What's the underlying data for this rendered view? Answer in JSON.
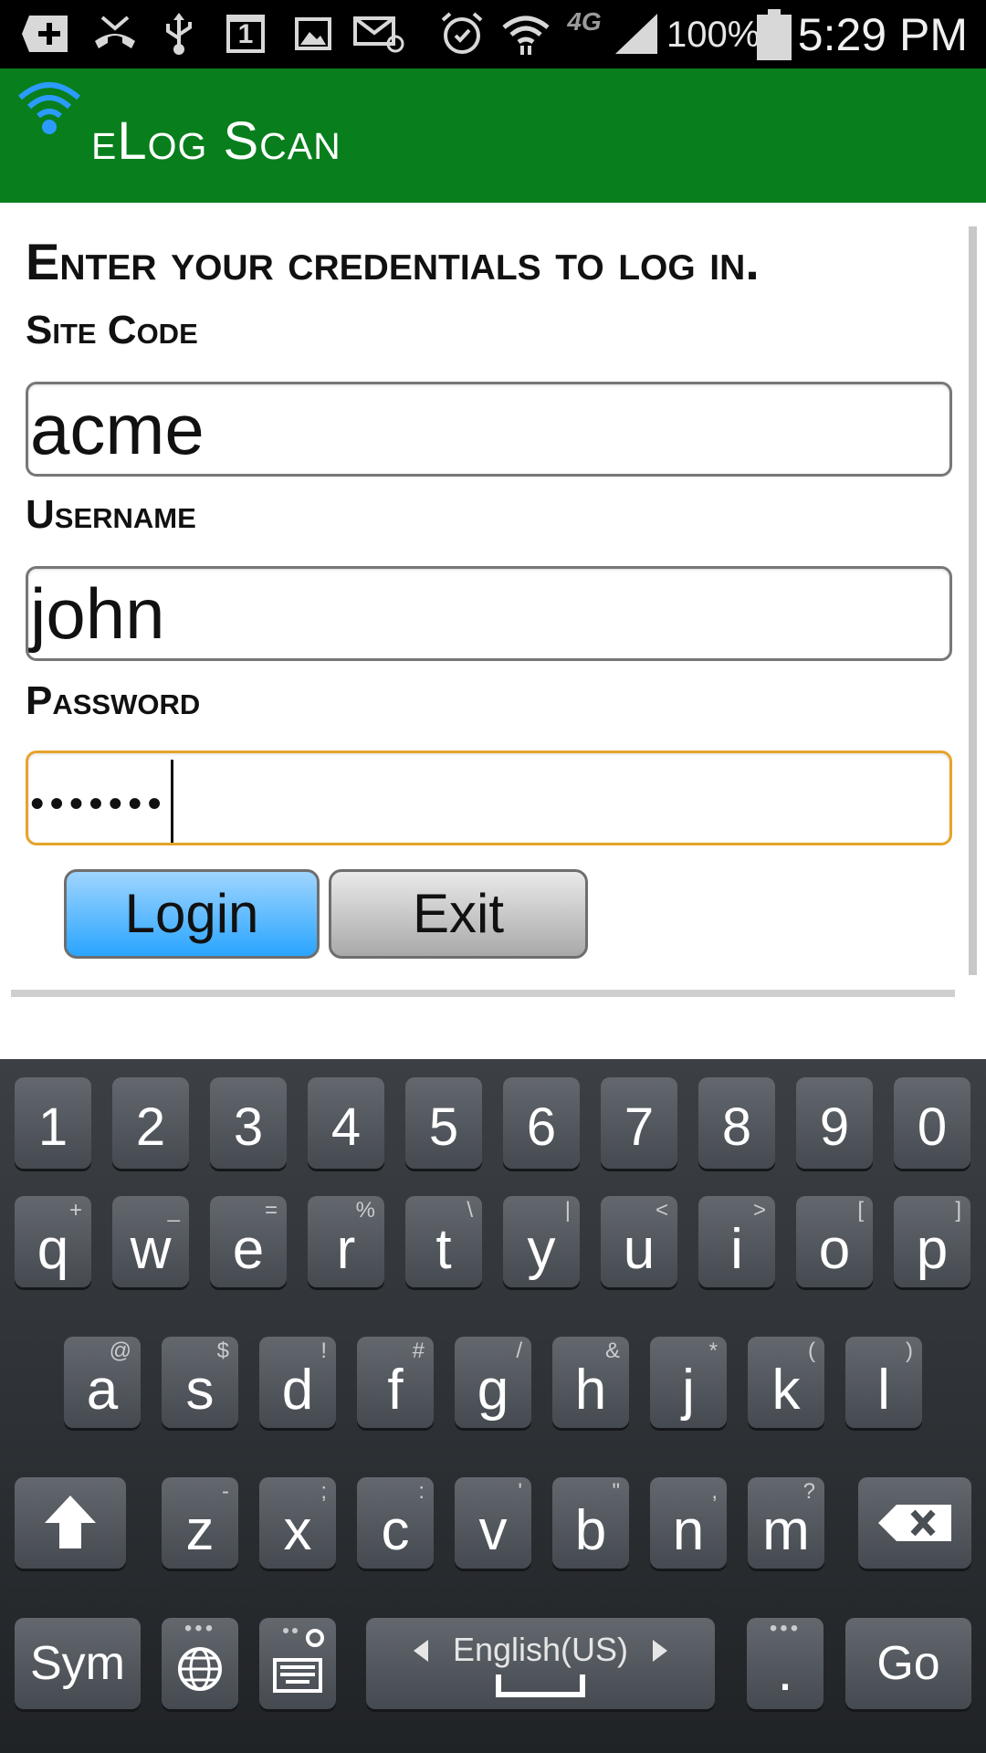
{
  "status_bar": {
    "calendar_day": "1",
    "network": "4G",
    "battery_percent": "100%",
    "time": "5:29 PM",
    "icons": [
      "add-icon",
      "missed-call-icon",
      "usb-icon",
      "calendar-icon",
      "image-icon",
      "email-icon",
      "alarm-icon",
      "wifi-icon",
      "network-4g-icon",
      "signal-icon",
      "battery-icon"
    ]
  },
  "action_bar": {
    "title": "eLog Scan",
    "icon": "wifi-signal-icon",
    "background_color": "#087f1c"
  },
  "form": {
    "heading": "Enter your credentials to log in.",
    "site_code": {
      "label": "Site Code",
      "value": "acme"
    },
    "username": {
      "label": "Username",
      "value": "john"
    },
    "password": {
      "label": "Password",
      "masked_value": "•••••••"
    },
    "login_label": "Login",
    "exit_label": "Exit",
    "focus_color": "#e6a42a"
  },
  "keyboard": {
    "number_row": [
      "1",
      "2",
      "3",
      "4",
      "5",
      "6",
      "7",
      "8",
      "9",
      "0"
    ],
    "row1": [
      {
        "key": "q",
        "alt": "+"
      },
      {
        "key": "w",
        "alt": "_"
      },
      {
        "key": "e",
        "alt": "="
      },
      {
        "key": "r",
        "alt": "%"
      },
      {
        "key": "t",
        "alt": "\\"
      },
      {
        "key": "y",
        "alt": "|"
      },
      {
        "key": "u",
        "alt": "<"
      },
      {
        "key": "i",
        "alt": ">"
      },
      {
        "key": "o",
        "alt": "["
      },
      {
        "key": "p",
        "alt": "]"
      }
    ],
    "row2": [
      {
        "key": "a",
        "alt": "@"
      },
      {
        "key": "s",
        "alt": "$"
      },
      {
        "key": "d",
        "alt": "!"
      },
      {
        "key": "f",
        "alt": "#"
      },
      {
        "key": "g",
        "alt": "/"
      },
      {
        "key": "h",
        "alt": "&"
      },
      {
        "key": "j",
        "alt": "*"
      },
      {
        "key": "k",
        "alt": "("
      },
      {
        "key": "l",
        "alt": ")"
      }
    ],
    "row3": [
      {
        "key": "z",
        "alt": "-"
      },
      {
        "key": "x",
        "alt": ";"
      },
      {
        "key": "c",
        "alt": ":"
      },
      {
        "key": "v",
        "alt": "'"
      },
      {
        "key": "b",
        "alt": "\""
      },
      {
        "key": "n",
        "alt": ","
      },
      {
        "key": "m",
        "alt": "?"
      }
    ],
    "sym_label": "Sym",
    "language_label": "English(US)",
    "period_label": ".",
    "go_label": "Go",
    "icons": [
      "shift-icon",
      "backspace-icon",
      "globe-icon",
      "keyboard-settings-icon",
      "space-icon"
    ]
  }
}
